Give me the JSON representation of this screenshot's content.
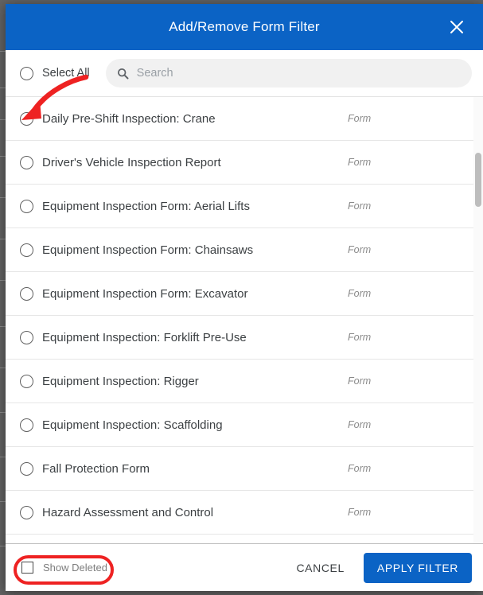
{
  "dialog": {
    "title": "Add/Remove Form Filter",
    "close_icon": "close-icon"
  },
  "toolbar": {
    "select_all_label": "Select All",
    "search_placeholder": "Search",
    "search_value": "",
    "search_icon": "search-icon"
  },
  "list": {
    "rows": [
      {
        "label": "Daily Pre-Shift Inspection: Crane",
        "type": "Form",
        "selected": false
      },
      {
        "label": "Driver's Vehicle Inspection Report",
        "type": "Form",
        "selected": false
      },
      {
        "label": "Equipment Inspection Form: Aerial Lifts",
        "type": "Form",
        "selected": false
      },
      {
        "label": "Equipment Inspection Form: Chainsaws",
        "type": "Form",
        "selected": false
      },
      {
        "label": "Equipment Inspection Form: Excavator",
        "type": "Form",
        "selected": false
      },
      {
        "label": "Equipment Inspection: Forklift Pre-Use",
        "type": "Form",
        "selected": false
      },
      {
        "label": "Equipment Inspection: Rigger",
        "type": "Form",
        "selected": false
      },
      {
        "label": "Equipment Inspection: Scaffolding",
        "type": "Form",
        "selected": false
      },
      {
        "label": "Fall Protection Form",
        "type": "Form",
        "selected": false
      },
      {
        "label": "Hazard Assessment and Control",
        "type": "Form",
        "selected": false
      }
    ]
  },
  "footer": {
    "show_deleted_label": "Show Deleted",
    "show_deleted_checked": false,
    "cancel_label": "CANCEL",
    "apply_label": "APPLY FILTER"
  },
  "colors": {
    "header_blue": "#0b63c5",
    "primary_button": "#0b63c5",
    "annotation_red": "#ee2222",
    "backdrop": "#636363",
    "row_divider": "#e6e6e6",
    "search_field": "#f1f1f1",
    "scroll_thumb": "#bdbdbd"
  },
  "annotations": [
    {
      "kind": "arrow",
      "target": "first-row-radio",
      "color": "#ee2222"
    },
    {
      "kind": "ellipse",
      "target": "show-deleted-checkbox",
      "color": "#ee2222"
    }
  ]
}
